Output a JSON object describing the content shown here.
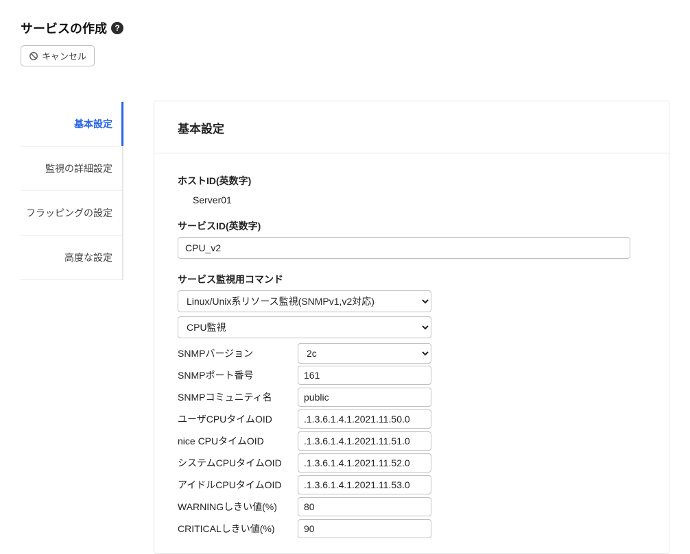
{
  "header": {
    "title": "サービスの作成",
    "help_icon": "?",
    "cancel_label": "キャンセル"
  },
  "sidebar": {
    "items": [
      {
        "label": "基本設定",
        "active": true
      },
      {
        "label": "監視の詳細設定",
        "active": false
      },
      {
        "label": "フラッピングの設定",
        "active": false
      },
      {
        "label": "高度な設定",
        "active": false
      }
    ]
  },
  "panel": {
    "title": "基本設定",
    "host_id_label": "ホストID(英数字)",
    "host_id_value": "Server01",
    "service_id_label": "サービスID(英数字)",
    "service_id_value": "CPU_v2",
    "command_label": "サービス監視用コマンド",
    "command_select1": "Linux/Unix系リソース監視(SNMPv1,v2対応)",
    "command_select2": "CPU監視",
    "params": [
      {
        "label": "SNMPバージョン",
        "type": "select",
        "value": "2c"
      },
      {
        "label": "SNMPポート番号",
        "type": "text",
        "value": "161"
      },
      {
        "label": "SNMPコミュニティ名",
        "type": "text",
        "value": "public"
      },
      {
        "label": "ユーザCPUタイムOID",
        "type": "text",
        "value": ".1.3.6.1.4.1.2021.11.50.0"
      },
      {
        "label": "nice CPUタイムOID",
        "type": "text",
        "value": ".1.3.6.1.4.1.2021.11.51.0"
      },
      {
        "label": "システムCPUタイムOID",
        "type": "text",
        "value": ".1.3.6.1.4.1.2021.11.52.0"
      },
      {
        "label": "アイドルCPUタイムOID",
        "type": "text",
        "value": ".1.3.6.1.4.1.2021.11.53.0"
      },
      {
        "label": "WARNINGしきい値(%)",
        "type": "text",
        "value": "80"
      },
      {
        "label": "CRITICALしきい値(%)",
        "type": "text",
        "value": "90"
      }
    ]
  }
}
